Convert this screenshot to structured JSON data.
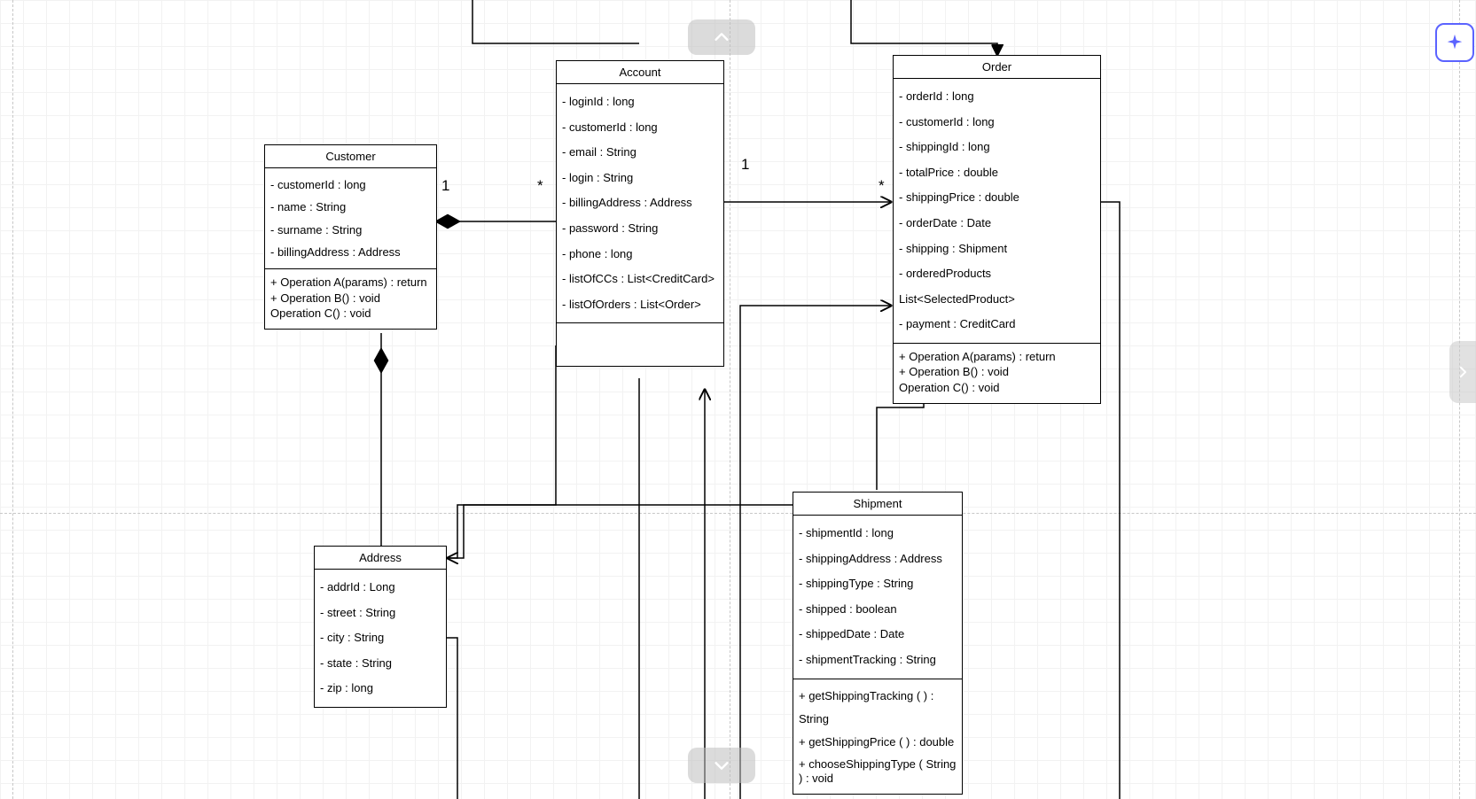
{
  "classes": {
    "customer": {
      "name": "Customer",
      "attrs": [
        "- customerId : long",
        "- name : String",
        "- surname : String",
        "- billingAddress : Address"
      ],
      "ops": [
        "+   Operation A(params) : return",
        "+   Operation B() : void",
        "     Operation C() : void"
      ]
    },
    "account": {
      "name": "Account",
      "attrs": [
        "- loginId : long",
        "- customerId : long",
        "- email : String",
        "- login : String",
        "- billingAddress : Address",
        "- password : String",
        "- phone : long",
        "- listOfCCs : List<CreditCard>",
        "- listOfOrders : List<Order>"
      ]
    },
    "order": {
      "name": "Order",
      "attrs": [
        "- orderId : long",
        "- customerId : long",
        "- shippingId : long",
        "- totalPrice : double",
        "- shippingPrice : double",
        "- orderDate : Date",
        "- shipping : Shipment",
        "- orderedProducts List<SelectedProduct>",
        "- payment : CreditCard"
      ],
      "ops": [
        "+    Operation A(params) : return",
        "+    Operation B() : void",
        "      Operation C() : void"
      ]
    },
    "address": {
      "name": "Address",
      "attrs": [
        "- addrId : Long",
        "- street : String",
        "- city : String",
        "- state : String",
        "- zip : long"
      ]
    },
    "shipment": {
      "name": "Shipment",
      "attrs": [
        "- shipmentId : long",
        "- shippingAddress : Address",
        "- shippingType : String",
        "- shipped : boolean",
        "- shippedDate : Date",
        "- shipmentTracking : String"
      ],
      "ops": [
        "+ getShippingTracking ( ) : String",
        "+ getShippingPrice ( ) : double",
        "+ chooseShippingType ( String ) : void"
      ]
    }
  },
  "multiplicity": {
    "customer_account_1": "1",
    "customer_account_star": "*",
    "account_order_1": "1",
    "account_order_star": "*"
  },
  "chart_data": {
    "type": "uml-class-diagram",
    "classes": [
      {
        "name": "Customer",
        "attributes": [
          {
            "vis": "-",
            "name": "customerId",
            "type": "long"
          },
          {
            "vis": "-",
            "name": "name",
            "type": "String"
          },
          {
            "vis": "-",
            "name": "surname",
            "type": "String"
          },
          {
            "vis": "-",
            "name": "billingAddress",
            "type": "Address"
          }
        ],
        "operations": [
          {
            "vis": "+",
            "signature": "Operation A(params)",
            "return": "return"
          },
          {
            "vis": "+",
            "signature": "Operation B()",
            "return": "void"
          },
          {
            "vis": "",
            "signature": "Operation C()",
            "return": "void"
          }
        ]
      },
      {
        "name": "Account",
        "attributes": [
          {
            "vis": "-",
            "name": "loginId",
            "type": "long"
          },
          {
            "vis": "-",
            "name": "customerId",
            "type": "long"
          },
          {
            "vis": "-",
            "name": "email",
            "type": "String"
          },
          {
            "vis": "-",
            "name": "login",
            "type": "String"
          },
          {
            "vis": "-",
            "name": "billingAddress",
            "type": "Address"
          },
          {
            "vis": "-",
            "name": "password",
            "type": "String"
          },
          {
            "vis": "-",
            "name": "phone",
            "type": "long"
          },
          {
            "vis": "-",
            "name": "listOfCCs",
            "type": "List<CreditCard>"
          },
          {
            "vis": "-",
            "name": "listOfOrders",
            "type": "List<Order>"
          }
        ],
        "operations": []
      },
      {
        "name": "Order",
        "attributes": [
          {
            "vis": "-",
            "name": "orderId",
            "type": "long"
          },
          {
            "vis": "-",
            "name": "customerId",
            "type": "long"
          },
          {
            "vis": "-",
            "name": "shippingId",
            "type": "long"
          },
          {
            "vis": "-",
            "name": "totalPrice",
            "type": "double"
          },
          {
            "vis": "-",
            "name": "shippingPrice",
            "type": "double"
          },
          {
            "vis": "-",
            "name": "orderDate",
            "type": "Date"
          },
          {
            "vis": "-",
            "name": "shipping",
            "type": "Shipment"
          },
          {
            "vis": "-",
            "name": "orderedProducts",
            "type": "List<SelectedProduct>"
          },
          {
            "vis": "-",
            "name": "payment",
            "type": "CreditCard"
          }
        ],
        "operations": [
          {
            "vis": "+",
            "signature": "Operation A(params)",
            "return": "return"
          },
          {
            "vis": "+",
            "signature": "Operation B()",
            "return": "void"
          },
          {
            "vis": "",
            "signature": "Operation C()",
            "return": "void"
          }
        ]
      },
      {
        "name": "Address",
        "attributes": [
          {
            "vis": "-",
            "name": "addrId",
            "type": "Long"
          },
          {
            "vis": "-",
            "name": "street",
            "type": "String"
          },
          {
            "vis": "-",
            "name": "city",
            "type": "String"
          },
          {
            "vis": "-",
            "name": "state",
            "type": "String"
          },
          {
            "vis": "-",
            "name": "zip",
            "type": "long"
          }
        ],
        "operations": []
      },
      {
        "name": "Shipment",
        "attributes": [
          {
            "vis": "-",
            "name": "shipmentId",
            "type": "long"
          },
          {
            "vis": "-",
            "name": "shippingAddress",
            "type": "Address"
          },
          {
            "vis": "-",
            "name": "shippingType",
            "type": "String"
          },
          {
            "vis": "-",
            "name": "shipped",
            "type": "boolean"
          },
          {
            "vis": "-",
            "name": "shippedDate",
            "type": "Date"
          },
          {
            "vis": "-",
            "name": "shipmentTracking",
            "type": "String"
          }
        ],
        "operations": [
          {
            "vis": "+",
            "signature": "getShippingTracking()",
            "return": "String"
          },
          {
            "vis": "+",
            "signature": "getShippingPrice()",
            "return": "double"
          },
          {
            "vis": "+",
            "signature": "chooseShippingType(String)",
            "return": "void"
          }
        ]
      }
    ],
    "relationships": [
      {
        "from": "Customer",
        "to": "Account",
        "type": "composition",
        "from_mult": "1",
        "to_mult": "*"
      },
      {
        "from": "Account",
        "to": "Order",
        "type": "association-directed",
        "from_mult": "1",
        "to_mult": "*"
      },
      {
        "from": "Customer",
        "to": "Address",
        "type": "composition"
      },
      {
        "from": "Account",
        "to": "Address",
        "type": "association-directed"
      },
      {
        "from": "Shipment",
        "to": "Address",
        "type": "association-directed"
      },
      {
        "from": "Order",
        "to": "Shipment",
        "type": "association"
      },
      {
        "from": "Account",
        "to": "Shipment",
        "type": "association"
      },
      {
        "from": "Order",
        "to": "CreditCard",
        "type": "association"
      }
    ]
  }
}
